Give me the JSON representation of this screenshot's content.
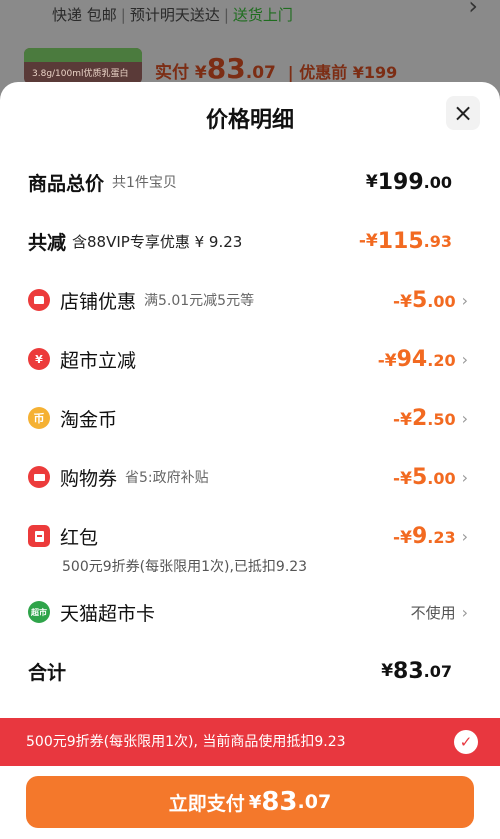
{
  "background": {
    "shipping": {
      "free_ship": "快递 包邮",
      "eta": "预计明天送达",
      "delivery": "送货上门"
    },
    "product_thumb_text": "3.8g/100ml优质乳蛋白",
    "pay_label": "实付",
    "pay_currency": "¥",
    "pay_int": "83",
    "pay_dec": ".07",
    "orig_label": "| 优惠前 ¥199"
  },
  "sheet": {
    "title": "价格明细",
    "close_icon": "×"
  },
  "rows": {
    "total": {
      "label": "商品总价",
      "sub": "共1件宝贝",
      "cur": "¥",
      "int": "199",
      "dec": ".00"
    },
    "reduce": {
      "label": "共减",
      "sub": "含88VIP专享优惠 ¥ 9.23",
      "cur": "-¥",
      "int": "115",
      "dec": ".93"
    },
    "store": {
      "label": "店铺优惠",
      "sub": "满5.01元减5元等",
      "cur": "-¥",
      "int": "5",
      "dec": ".00"
    },
    "market": {
      "label": "超市立减",
      "icon_glyph": "¥",
      "cur": "-¥",
      "int": "94",
      "dec": ".20"
    },
    "coin": {
      "label": "淘金币",
      "icon_glyph": "币",
      "cur": "-¥",
      "int": "2",
      "dec": ".50"
    },
    "coupon": {
      "label": "购物券",
      "sub": "省5:政府补贴",
      "cur": "-¥",
      "int": "5",
      "dec": ".00"
    },
    "hongbao": {
      "label": "红包",
      "note": "500元9折券(每张限用1次),已抵扣9.23",
      "cur": "-¥",
      "int": "9",
      "dec": ".23"
    },
    "card": {
      "label": "天猫超市卡",
      "icon_glyph": "超市",
      "value": "不使用"
    },
    "sum": {
      "label": "合计",
      "cur": "¥",
      "int": "83",
      "dec": ".07"
    }
  },
  "banner": {
    "text": "500元9折券(每张限用1次), 当前商品使用抵扣9.23"
  },
  "pay_button": {
    "label": "立即支付",
    "cur": "¥",
    "int": "83",
    "dec": ".07"
  },
  "colors": {
    "accent": "#f26a21",
    "button": "#f4782b",
    "banner": "#e8373f"
  }
}
